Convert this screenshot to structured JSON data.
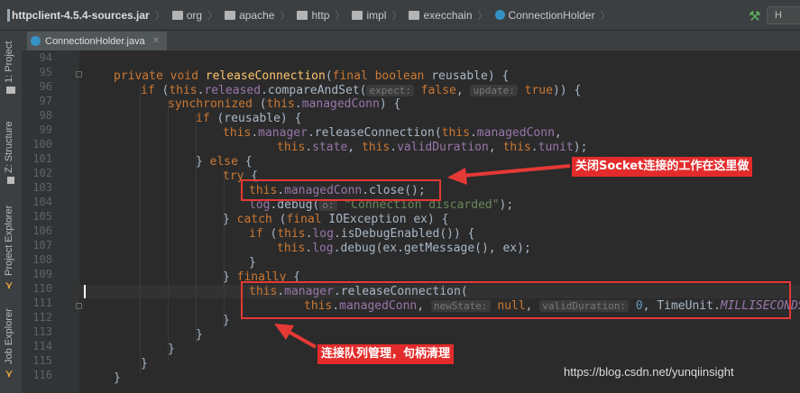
{
  "breadcrumb": [
    {
      "label": "httpclient-4.5.4-sources.jar",
      "icon": "jar-icon"
    },
    {
      "label": "org",
      "icon": "folder-icon"
    },
    {
      "label": "apache",
      "icon": "folder-icon"
    },
    {
      "label": "http",
      "icon": "folder-icon"
    },
    {
      "label": "impl",
      "icon": "folder-icon"
    },
    {
      "label": "execchain",
      "icon": "folder-icon"
    },
    {
      "label": "ConnectionHolder",
      "icon": "class-icon"
    }
  ],
  "toolbar": {
    "run_config_label": "H"
  },
  "sidebar": {
    "project": "1: Project",
    "structure": "Z: Structure",
    "project_explorer": "Project Explorer",
    "job_explorer": "Job Explorer"
  },
  "editor": {
    "tab_label": "ConnectionHolder.java"
  },
  "line_numbers": [
    "94",
    "95",
    "96",
    "97",
    "98",
    "99",
    "100",
    "101",
    "102",
    "103",
    "104",
    "105",
    "106",
    "107",
    "108",
    "109",
    "110",
    "111",
    "112",
    "113",
    "114",
    "115",
    "116"
  ],
  "code": {
    "l95_a": "private void ",
    "l95_fn": "releaseConnection",
    "l95_b": "(",
    "l95_kw": "final boolean ",
    "l95_c": "reusable) {",
    "l96_kw": "if ",
    "l96_a": "(",
    "l96_this": "this",
    "l96_b": ".",
    "l96_fld": "released",
    "l96_c": ".compareAndSet(",
    "l96_hint1": "expect:",
    "l96_v1": " false",
    "l96_d": ", ",
    "l96_hint2": "update:",
    "l96_v2": " true",
    "l96_e": ")) {",
    "l97_kw": "synchronized ",
    "l97_a": "(",
    "l97_this": "this",
    "l97_b": ".",
    "l97_fld": "managedConn",
    "l97_c": ") {",
    "l98_kw": "if ",
    "l98_a": "(reusable) {",
    "l99_this": "this",
    "l99_a": ".",
    "l99_fld": "manager",
    "l99_b": ".releaseConnection(",
    "l99_this2": "this",
    "l99_c": ".",
    "l99_fld2": "managedConn",
    "l99_d": ",",
    "l100_this1": "this",
    "l100_a": ".",
    "l100_fld1": "state",
    "l100_b": ", ",
    "l100_this2": "this",
    "l100_c": ".",
    "l100_fld2": "validDuration",
    "l100_d": ", ",
    "l100_this3": "this",
    "l100_e": ".",
    "l100_fld3": "tunit",
    "l100_f": ");",
    "l101_a": "} ",
    "l101_kw": "else",
    "l101_b": " {",
    "l102_kw": "try",
    "l102_a": " {",
    "l103_this": "this",
    "l103_a": ".",
    "l103_fld": "managedConn",
    "l103_b": ".close();",
    "l104_fld": "log",
    "l104_a": ".debug(",
    "l104_hint": "o:",
    "l104_str": " \"Connection discarded\"",
    "l104_b": ");",
    "l105_a": "} ",
    "l105_kw": "catch",
    "l105_b": " (",
    "l105_kw2": "final ",
    "l105_c": "IOException ex) {",
    "l106_kw": "if ",
    "l106_a": "(",
    "l106_this": "this",
    "l106_b": ".",
    "l106_fld": "log",
    "l106_c": ".isDebugEnabled()) {",
    "l107_this": "this",
    "l107_a": ".",
    "l107_fld": "log",
    "l107_b": ".debug(ex.getMessage(), ex);",
    "l108": "}",
    "l109_a": "} ",
    "l109_kw": "finally",
    "l109_b": " {",
    "l110_this": "this",
    "l110_a": ".",
    "l110_fld": "manager",
    "l110_b": ".releaseConnection(",
    "l111_this": "this",
    "l111_a": ".",
    "l111_fld": "managedConn",
    "l111_b": ", ",
    "l111_hint1": "newState:",
    "l111_v1": " null",
    "l111_c": ", ",
    "l111_hint2": "validDuration:",
    "l111_v2": " 0",
    "l111_d": ", TimeUnit.",
    "l111_it": "MILLISECONDS",
    "l111_e": ");",
    "l112": "}",
    "l113": "}",
    "l114": "}",
    "l115": "}",
    "l116": "}"
  },
  "annotations": {
    "callout_top": "关闭Socket连接的工作在这里做",
    "callout_bottom": "连接队列管理，句柄清理",
    "arrow_color": "#e53935"
  },
  "watermark": "https://blog.csdn.net/yunqiinsight",
  "colors": {
    "keyword": "#cc7832",
    "method": "#ffc66d",
    "field": "#9876aa",
    "string": "#6a8759",
    "number": "#6897bb",
    "text": "#a9b7c6"
  }
}
